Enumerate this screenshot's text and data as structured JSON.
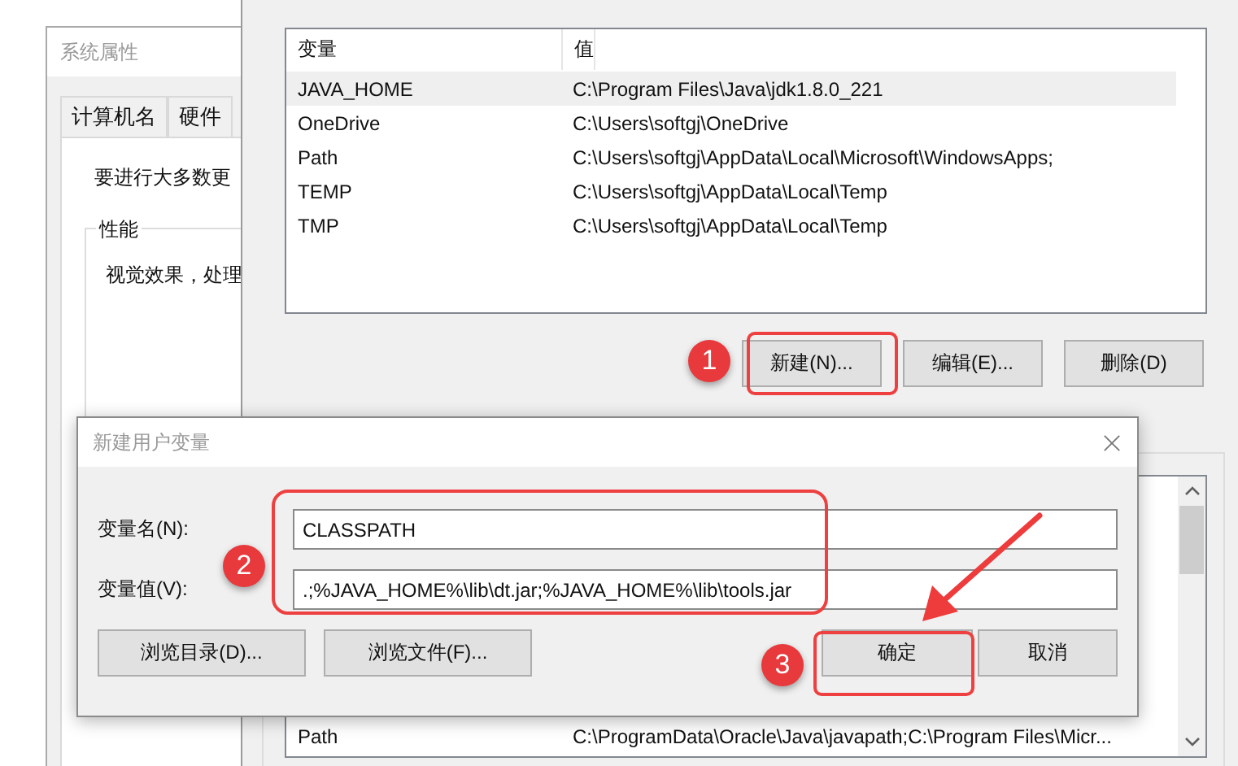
{
  "system_properties": {
    "title": "系统属性",
    "tabs": [
      {
        "label": "计算机名",
        "selected": false
      },
      {
        "label": "硬件",
        "selected": false
      }
    ],
    "notice": "要进行大多数更",
    "group": {
      "title": "性能",
      "text": "视觉效果，处理"
    }
  },
  "environment_variables": {
    "user_variables": {
      "columns": [
        "变量",
        "值"
      ],
      "rows": [
        {
          "name": "JAVA_HOME",
          "value": "C:\\Program Files\\Java\\jdk1.8.0_221",
          "selected": true
        },
        {
          "name": "OneDrive",
          "value": "C:\\Users\\softgj\\OneDrive",
          "selected": false
        },
        {
          "name": "Path",
          "value": "C:\\Users\\softgj\\AppData\\Local\\Microsoft\\WindowsApps;",
          "selected": false
        },
        {
          "name": "TEMP",
          "value": "C:\\Users\\softgj\\AppData\\Local\\Temp",
          "selected": false
        },
        {
          "name": "TMP",
          "value": "C:\\Users\\softgj\\AppData\\Local\\Temp",
          "selected": false
        }
      ]
    },
    "buttons": [
      "新建(N)...",
      "编辑(E)...",
      "删除(D)"
    ],
    "system_variables": {
      "rows": [
        {
          "name": "Path",
          "value": "C:\\ProgramData\\Oracle\\Java\\javapath;C:\\Program Files\\Micr..."
        }
      ]
    }
  },
  "dialog": {
    "title": "新建用户变量",
    "fields": [
      {
        "label": "变量名(N):",
        "value": "CLASSPATH"
      },
      {
        "label": "变量值(V):",
        "value": ".;%JAVA_HOME%\\lib\\dt.jar;%JAVA_HOME%\\lib\\tools.jar"
      }
    ],
    "browse_buttons": [
      "浏览目录(D)...",
      "浏览文件(F)..."
    ],
    "buttons": [
      "确定",
      "取消"
    ]
  },
  "annotations": [
    {
      "number": "1"
    },
    {
      "number": "2"
    },
    {
      "number": "3"
    }
  ]
}
